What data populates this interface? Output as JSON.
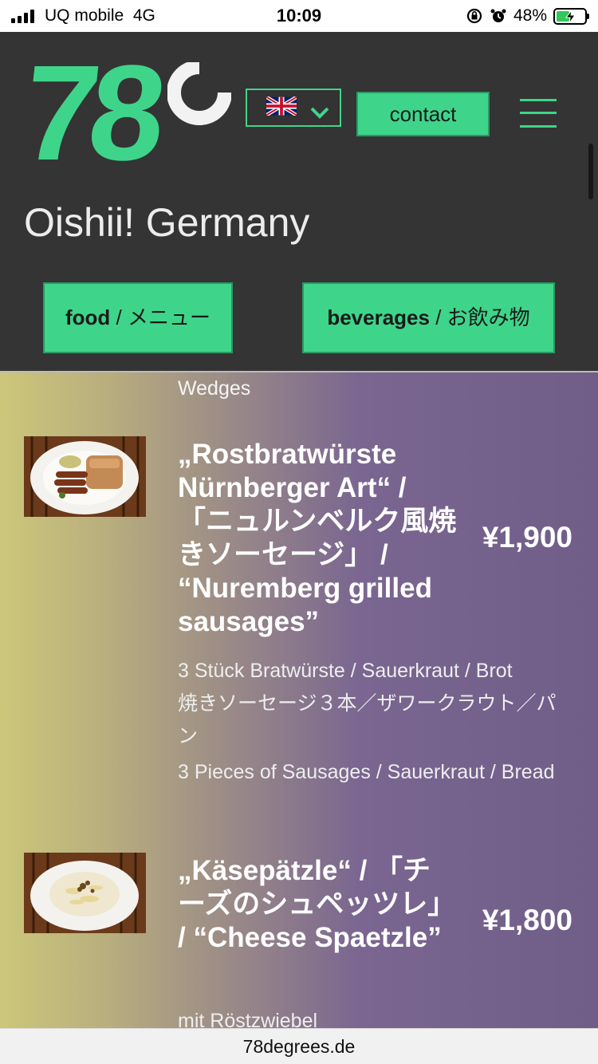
{
  "status_bar": {
    "carrier": "UQ mobile",
    "network": "4G",
    "time": "10:09",
    "battery": "48%",
    "battery_level": 0.48
  },
  "header": {
    "logo_text": "78",
    "language": "English (UK flag)",
    "contact_label": "contact",
    "site_title": "Oishii! Germany",
    "tabs": [
      {
        "label_en": "food",
        "sep": " / ",
        "label_ja": "メニュー"
      },
      {
        "label_en": "beverages",
        "sep": " / ",
        "label_ja": "お飲み物"
      }
    ]
  },
  "menu": {
    "previous_desc_tail": "Wedges",
    "items": [
      {
        "name": "„Rostbratwürste Nürnberger Art“ / 「ニュルンベルク風焼きソーセージ」 / “Nuremberg grilled sausages”",
        "price": "¥1,900",
        "desc_lines": [
          "3 Stück Bratwürste / Sauerkraut / Brot",
          "焼きソーセージ３本／ザワークラウト／パン",
          "3 Pieces of Sausages / Sauerkraut / Bread"
        ],
        "image": "sausages-photo"
      },
      {
        "name": "„Käsepätzle“ / 「チーズのシュペッツレ」 / “Cheese Spaetzle”",
        "price": "¥1,800",
        "desc_lines": [
          "mit Röstzwiebel"
        ],
        "image": "spaetzle-photo"
      }
    ]
  },
  "browser": {
    "url": "78degrees.de"
  },
  "colors": {
    "accent": "#3ed58a",
    "header_bg": "#343434"
  }
}
